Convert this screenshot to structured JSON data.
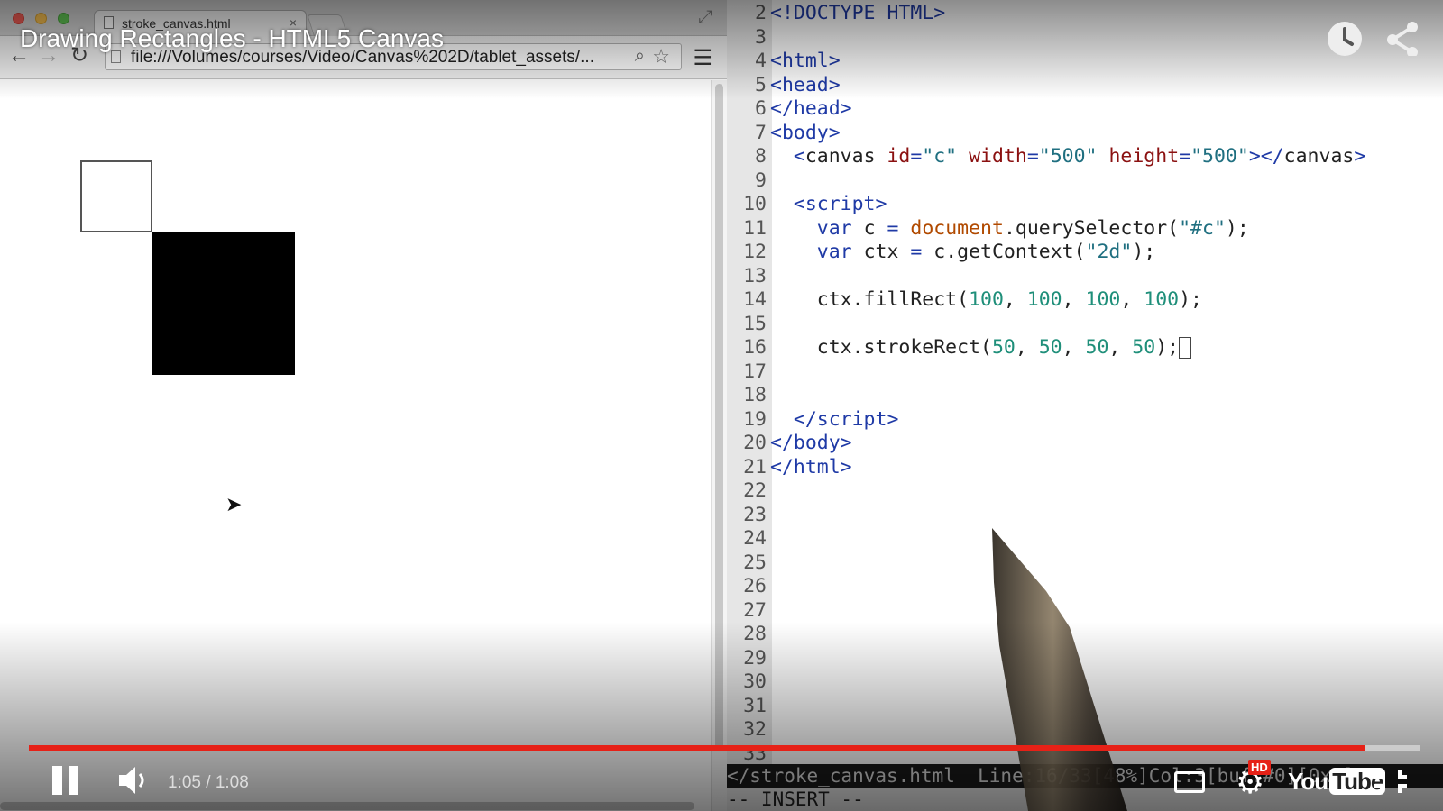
{
  "video": {
    "title": "Drawing Rectangles - HTML5 Canvas",
    "time_display": "1:05 / 1:08",
    "progress": 0.961,
    "hd_badge": "HD",
    "logo_you": "You",
    "logo_tube": "Tube"
  },
  "browser": {
    "tab_title": "stroke_canvas.html",
    "tab_close": "×",
    "url": "file:///Volumes/courses/Video/Canvas%202D/tablet_assets/..."
  },
  "editor": {
    "lines": [
      {
        "n": "2",
        "html": "<span class='punc'>&lt;!DOCTYPE HTML&gt;</span>"
      },
      {
        "n": "3",
        "html": ""
      },
      {
        "n": "4",
        "html": "<span class='tag'>&lt;html&gt;</span>"
      },
      {
        "n": "5",
        "html": "<span class='tag'>&lt;head&gt;</span>"
      },
      {
        "n": "6",
        "html": "<span class='tag'>&lt;/head&gt;</span>"
      },
      {
        "n": "7",
        "html": "<span class='tag'>&lt;body&gt;</span>"
      },
      {
        "n": "8",
        "html": "  <span class='punc'>&lt;</span>canvas <span class='attr'>id</span><span class='op'>=</span><span class='str'>\"c\"</span> <span class='attr'>width</span><span class='op'>=</span><span class='str'>\"500\"</span> <span class='attr'>height</span><span class='op'>=</span><span class='str'>\"500\"</span><span class='punc'>&gt;&lt;/</span>canvas<span class='punc'>&gt;</span>"
      },
      {
        "n": "9",
        "html": ""
      },
      {
        "n": "10",
        "html": "  <span class='tag'>&lt;script&gt;</span>"
      },
      {
        "n": "11",
        "html": "    <span class='kw'>var</span> c <span class='op'>=</span> <span class='obj'>document</span>.querySelector(<span class='str'>\"#c\"</span>);"
      },
      {
        "n": "12",
        "html": "    <span class='kw'>var</span> ctx <span class='op'>=</span> c.getContext(<span class='str'>\"2d\"</span>);"
      },
      {
        "n": "13",
        "html": ""
      },
      {
        "n": "14",
        "html": "    ctx.fillRect(<span class='num'>100</span>, <span class='num'>100</span>, <span class='num'>100</span>, <span class='num'>100</span>);"
      },
      {
        "n": "15",
        "html": ""
      },
      {
        "n": "16",
        "html": "    ctx.strokeRect(<span class='num'>50</span>, <span class='num'>50</span>, <span class='num'>50</span>, <span class='num'>50</span>);<span id='text-cursor' data-name='text-cursor' data-interactable='false'></span>"
      },
      {
        "n": "17",
        "html": ""
      },
      {
        "n": "18",
        "html": ""
      },
      {
        "n": "19",
        "html": "  <span class='tag'>&lt;/script&gt;</span>"
      },
      {
        "n": "20",
        "html": "<span class='tag'>&lt;/body&gt;</span>"
      },
      {
        "n": "21",
        "html": "<span class='tag'>&lt;/html&gt;</span>"
      },
      {
        "n": "22",
        "html": ""
      },
      {
        "n": "23",
        "html": ""
      },
      {
        "n": "24",
        "html": ""
      },
      {
        "n": "25",
        "html": ""
      },
      {
        "n": "26",
        "html": ""
      },
      {
        "n": "27",
        "html": ""
      },
      {
        "n": "28",
        "html": ""
      },
      {
        "n": "29",
        "html": ""
      },
      {
        "n": "30",
        "html": ""
      },
      {
        "n": "31",
        "html": ""
      },
      {
        "n": "32",
        "html": ""
      },
      {
        "n": "33",
        "html": ""
      }
    ],
    "status_line": "</stroke_canvas.html  Line:16/33[48%]Col:3[buf:#0][0x0]",
    "mode_line": "-- INSERT --"
  },
  "icons": {
    "back": "back-icon",
    "forward": "forward-icon",
    "reload": "reload-icon",
    "zoom": "zoom-icon",
    "star": "star-icon",
    "menu": "menu-icon",
    "watch_later": "clock-icon",
    "share": "share-icon",
    "volume": "volume-icon",
    "captions": "captions-icon",
    "settings": "gear-icon",
    "fullscreen": "fullscreen-icon"
  },
  "colors": {
    "progress": "#e62117",
    "hd_badge": "#e62117"
  }
}
